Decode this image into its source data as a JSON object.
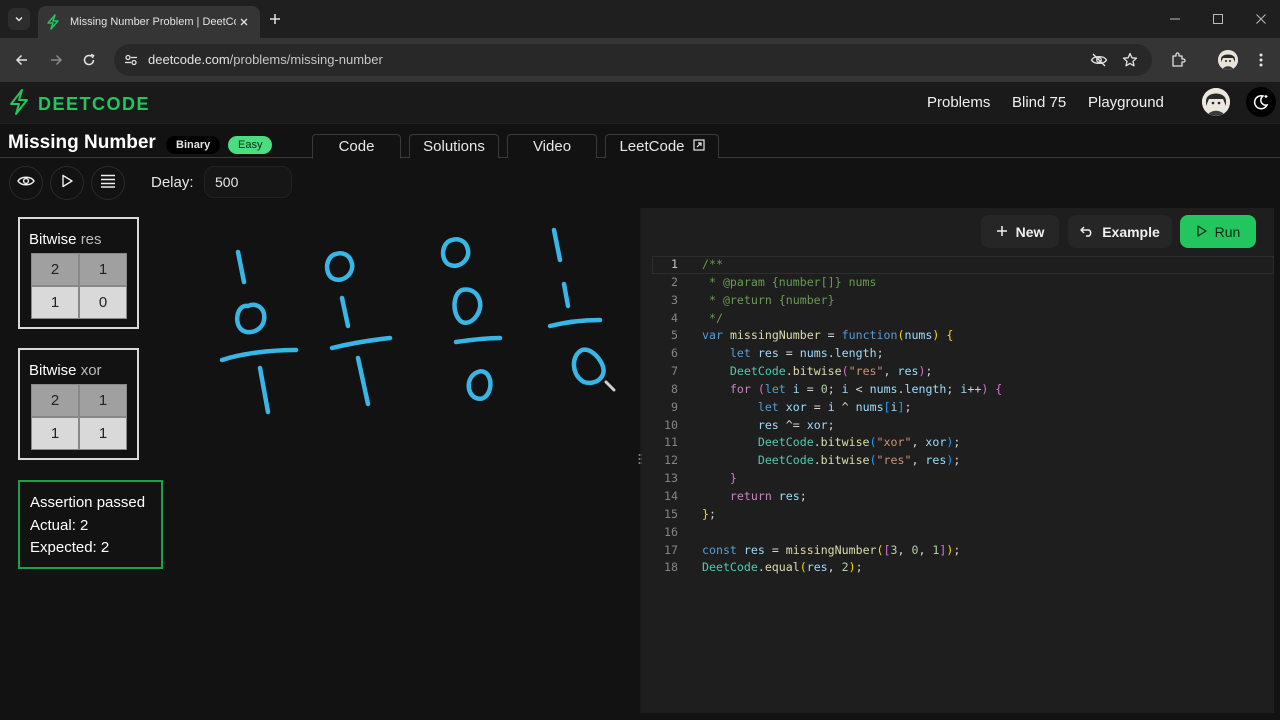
{
  "browser": {
    "tab_title": "Missing Number Problem | DeetCode",
    "url_host": "deetcode.com",
    "url_path": "/problems/missing-number"
  },
  "site": {
    "logo_text": "DEETCODE",
    "brand_color": "#22c55e",
    "nav": [
      "Problems",
      "Blind 75",
      "Playground"
    ]
  },
  "problem": {
    "title": "Missing Number",
    "tag": "Binary",
    "difficulty": "Easy",
    "tabs": [
      "Code",
      "Solutions",
      "Video",
      "LeetCode"
    ],
    "active_tab": "Code"
  },
  "toolbar": {
    "delay_label": "Delay:",
    "delay_value": "500"
  },
  "visualizer": {
    "bitwise_label": "Bitwise",
    "cards": [
      {
        "var": "res",
        "head": [
          "2",
          "1"
        ],
        "body": [
          "1",
          "0"
        ]
      },
      {
        "var": "xor",
        "head": [
          "2",
          "1"
        ],
        "body": [
          "1",
          "1"
        ]
      }
    ],
    "assertion": {
      "status": "Assertion passed",
      "actual": "Actual: 2",
      "expected": "Expected: 2"
    },
    "drawing_digits": [
      "1/0",
      "0/1",
      "0/0",
      "1/0"
    ]
  },
  "editor": {
    "buttons": {
      "new": "New",
      "example": "Example",
      "run": "Run"
    },
    "line_numbers": [
      "1",
      "2",
      "3",
      "4",
      "5",
      "6",
      "7",
      "8",
      "9",
      "10",
      "11",
      "12",
      "13",
      "14",
      "15",
      "16",
      "17",
      "18"
    ]
  }
}
